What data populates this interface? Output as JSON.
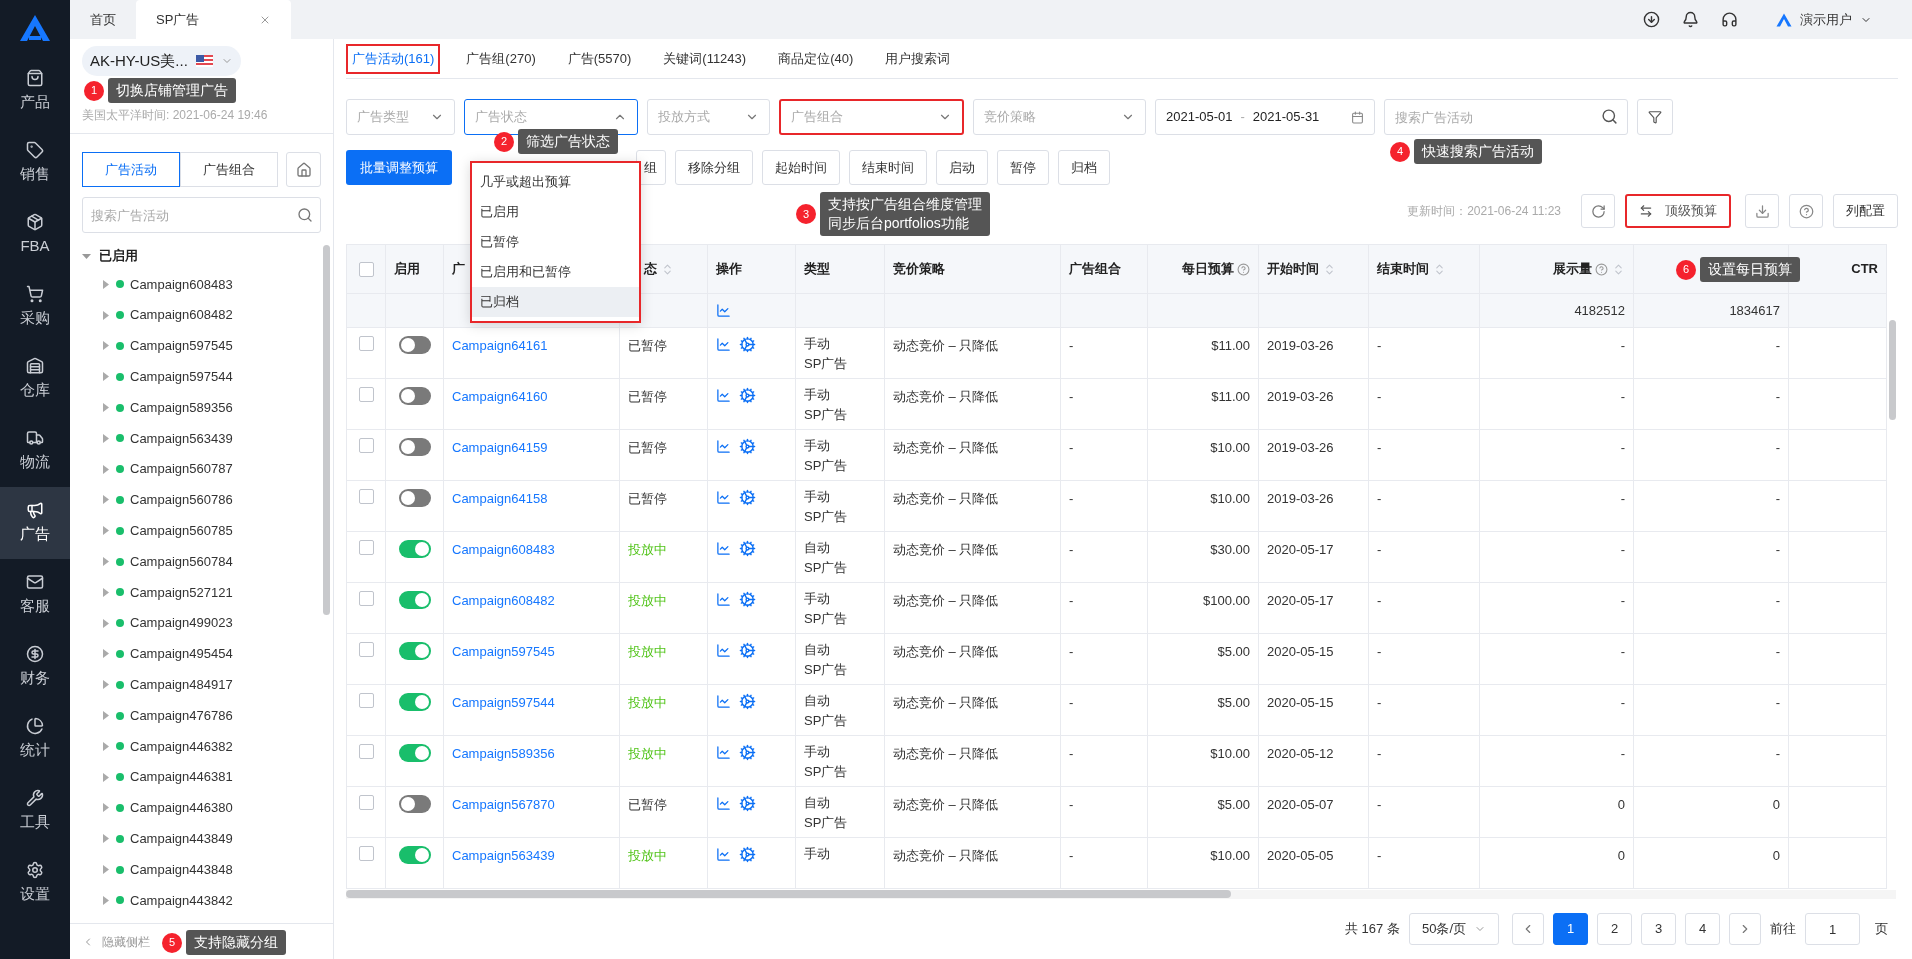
{
  "nav": {
    "items": [
      {
        "label": "产品",
        "selected": false
      },
      {
        "label": "销售",
        "selected": false
      },
      {
        "label": "FBA",
        "selected": false
      },
      {
        "label": "采购",
        "selected": false
      },
      {
        "label": "仓库",
        "selected": false
      },
      {
        "label": "物流",
        "selected": false
      },
      {
        "label": "广告",
        "selected": true
      },
      {
        "label": "客服",
        "selected": false
      },
      {
        "label": "财务",
        "selected": false
      },
      {
        "label": "统计",
        "selected": false
      },
      {
        "label": "工具",
        "selected": false
      },
      {
        "label": "设置",
        "selected": false
      }
    ]
  },
  "tabs": [
    {
      "label": "首页",
      "selected": false,
      "closable": false
    },
    {
      "label": "SP广告",
      "selected": true,
      "closable": true
    }
  ],
  "user": {
    "name": "演示用户"
  },
  "sidebar": {
    "store": "AK-HY-US美...",
    "time": "美国太平洋时间: 2021-06-24 19:46",
    "segments": [
      {
        "label": "广告活动",
        "selected": true
      },
      {
        "label": "广告组合",
        "selected": false
      }
    ],
    "search_placeholder": "搜索广告活动",
    "tree": {
      "label": "已启用",
      "expanded": true,
      "children": [
        {
          "label": "Campaign608483",
          "color": "#19be6b",
          "expanded": false
        },
        {
          "label": "Campaign608482",
          "color": "#19be6b",
          "expanded": false
        },
        {
          "label": "Campaign597545",
          "color": "#19be6b",
          "expanded": false
        },
        {
          "label": "Campaign597544",
          "color": "#19be6b",
          "expanded": false
        },
        {
          "label": "Campaign589356",
          "color": "#19be6b",
          "expanded": false
        },
        {
          "label": "Campaign563439",
          "color": "#19be6b",
          "expanded": false
        },
        {
          "label": "Campaign560787",
          "color": "#19be6b",
          "expanded": false
        },
        {
          "label": "Campaign560786",
          "color": "#19be6b",
          "expanded": false
        },
        {
          "label": "Campaign560785",
          "color": "#19be6b",
          "expanded": false
        },
        {
          "label": "Campaign560784",
          "color": "#19be6b",
          "expanded": false
        },
        {
          "label": "Campaign527121",
          "color": "#19be6b",
          "expanded": false
        },
        {
          "label": "Campaign499023",
          "color": "#19be6b",
          "expanded": false
        },
        {
          "label": "Campaign495454",
          "color": "#19be6b",
          "expanded": false
        },
        {
          "label": "Campaign484917",
          "color": "#19be6b",
          "expanded": false
        },
        {
          "label": "Campaign476786",
          "color": "#19be6b",
          "expanded": false
        },
        {
          "label": "Campaign446382",
          "color": "#19be6b",
          "expanded": false
        },
        {
          "label": "Campaign446381",
          "color": "#19be6b",
          "expanded": false
        },
        {
          "label": "Campaign446380",
          "color": "#19be6b",
          "expanded": false
        },
        {
          "label": "Campaign443849",
          "color": "#19be6b",
          "expanded": false
        },
        {
          "label": "Campaign443848",
          "color": "#19be6b",
          "expanded": false
        },
        {
          "label": "Campaign443842",
          "color": "#19be6b",
          "expanded": false
        }
      ]
    },
    "footer": "隐藏侧栏"
  },
  "page_tabs": [
    {
      "label": "广告活动(161)",
      "selected": true,
      "highlighted": true
    },
    {
      "label": "广告组(270)",
      "selected": false,
      "highlighted": false
    },
    {
      "label": "广告(5570)",
      "selected": false,
      "highlighted": false
    },
    {
      "label": "关键词(11243)",
      "selected": false,
      "highlighted": false
    },
    {
      "label": "商品定位(40)",
      "selected": false,
      "highlighted": false
    },
    {
      "label": "用户搜索词",
      "selected": false,
      "highlighted": false
    }
  ],
  "filters": [
    {
      "placeholder": "广告类型",
      "open": false,
      "highlighted": false
    },
    {
      "placeholder": "广告状态",
      "open": true,
      "highlighted": false
    },
    {
      "placeholder": "投放方式",
      "open": false,
      "highlighted": false
    },
    {
      "placeholder": "广告组合",
      "open": false,
      "highlighted": true
    },
    {
      "placeholder": "竞价策略",
      "open": false,
      "highlighted": false
    }
  ],
  "date_range": {
    "start": "2021-05-01",
    "separator": "-",
    "end": "2021-05-31"
  },
  "search": {
    "placeholder": "搜索广告活动"
  },
  "dropdown": {
    "highlighted": true,
    "items": [
      {
        "label": "几乎或超出预算",
        "hovered": false
      },
      {
        "label": "已启用",
        "hovered": false
      },
      {
        "label": "已暂停",
        "hovered": false
      },
      {
        "label": "已启用和已暂停",
        "hovered": false
      },
      {
        "label": "已归档",
        "hovered": true
      }
    ]
  },
  "actions": [
    {
      "label": "批量调整预算",
      "kind": "primary"
    },
    {
      "label": "组",
      "kind": "covered"
    },
    {
      "label": "移除分组",
      "kind": "default"
    },
    {
      "label": "起始时间",
      "kind": "default"
    },
    {
      "label": "结束时间",
      "kind": "default"
    },
    {
      "label": "启动",
      "kind": "default"
    },
    {
      "label": "暂停",
      "kind": "default"
    },
    {
      "label": "归档",
      "kind": "default"
    }
  ],
  "update_time": "更新时间：2021-06-24 11:23",
  "top_budget": {
    "label": "顶级预算",
    "highlighted": true
  },
  "column_config": "列配置",
  "table": {
    "all_checked": false,
    "columns": [
      {
        "kind": "checkbox"
      },
      {
        "label": "启用",
        "kind": "text",
        "sortable": false,
        "help": false
      },
      {
        "label": "广",
        "kind": "text"
      },
      {
        "label": "态",
        "kind": "text",
        "sortable": true,
        "help": false
      },
      {
        "label": "操作",
        "kind": "text",
        "sortable": false,
        "help": false
      },
      {
        "label": "类型",
        "kind": "text",
        "sortable": false,
        "help": false
      },
      {
        "label": "竞价策略",
        "kind": "text",
        "sortable": false,
        "help": false
      },
      {
        "label": "广告组合",
        "kind": "text",
        "sortable": false,
        "help": false
      },
      {
        "label": "每日预算",
        "kind": "right",
        "sortable": false,
        "help": true
      },
      {
        "label": "开始时间",
        "kind": "text",
        "sortable": true,
        "help": false
      },
      {
        "label": "结束时间",
        "kind": "text",
        "sortable": true,
        "help": false
      },
      {
        "label": "展示量",
        "kind": "right",
        "sortable": true,
        "help": true
      },
      {
        "kind": "right"
      },
      {
        "label": "CTR",
        "kind": "right",
        "sortable": false,
        "help": false
      }
    ],
    "summary": {
      "impressions": "4182512",
      "column_13": "1834617"
    },
    "rows": [
      {
        "checked": false,
        "on": false,
        "name": "Campaign64161",
        "status": "已暂停",
        "delivering": false,
        "type": [
          "手动",
          "SP广告"
        ],
        "bidding": "动态竞价 – 只降低",
        "portfolio": "-",
        "budget": "$11.00",
        "start": "2019-03-26",
        "end": "-",
        "impressions": "-",
        "column_13": "-"
      },
      {
        "checked": false,
        "on": false,
        "name": "Campaign64160",
        "status": "已暂停",
        "delivering": false,
        "type": [
          "手动",
          "SP广告"
        ],
        "bidding": "动态竞价 – 只降低",
        "portfolio": "-",
        "budget": "$11.00",
        "start": "2019-03-26",
        "end": "-",
        "impressions": "-",
        "column_13": "-"
      },
      {
        "checked": false,
        "on": false,
        "name": "Campaign64159",
        "status": "已暂停",
        "delivering": false,
        "type": [
          "手动",
          "SP广告"
        ],
        "bidding": "动态竞价 – 只降低",
        "portfolio": "-",
        "budget": "$10.00",
        "start": "2019-03-26",
        "end": "-",
        "impressions": "-",
        "column_13": "-"
      },
      {
        "checked": false,
        "on": false,
        "name": "Campaign64158",
        "status": "已暂停",
        "delivering": false,
        "type": [
          "手动",
          "SP广告"
        ],
        "bidding": "动态竞价 – 只降低",
        "portfolio": "-",
        "budget": "$10.00",
        "start": "2019-03-26",
        "end": "-",
        "impressions": "-",
        "column_13": "-"
      },
      {
        "checked": false,
        "on": true,
        "name": "Campaign608483",
        "status": "投放中",
        "delivering": true,
        "type": [
          "自动",
          "SP广告"
        ],
        "bidding": "动态竞价 – 只降低",
        "portfolio": "-",
        "budget": "$30.00",
        "start": "2020-05-17",
        "end": "-",
        "impressions": "-",
        "column_13": "-"
      },
      {
        "checked": false,
        "on": true,
        "name": "Campaign608482",
        "status": "投放中",
        "delivering": true,
        "type": [
          "手动",
          "SP广告"
        ],
        "bidding": "动态竞价 – 只降低",
        "portfolio": "-",
        "budget": "$100.00",
        "start": "2020-05-17",
        "end": "-",
        "impressions": "-",
        "column_13": "-"
      },
      {
        "checked": false,
        "on": true,
        "name": "Campaign597545",
        "status": "投放中",
        "delivering": true,
        "type": [
          "自动",
          "SP广告"
        ],
        "bidding": "动态竞价 – 只降低",
        "portfolio": "-",
        "budget": "$5.00",
        "start": "2020-05-15",
        "end": "-",
        "impressions": "-",
        "column_13": "-"
      },
      {
        "checked": false,
        "on": true,
        "name": "Campaign597544",
        "status": "投放中",
        "delivering": true,
        "type": [
          "自动",
          "SP广告"
        ],
        "bidding": "动态竞价 – 只降低",
        "portfolio": "-",
        "budget": "$5.00",
        "start": "2020-05-15",
        "end": "-",
        "impressions": "-",
        "column_13": "-"
      },
      {
        "checked": false,
        "on": true,
        "name": "Campaign589356",
        "status": "投放中",
        "delivering": true,
        "type": [
          "手动",
          "SP广告"
        ],
        "bidding": "动态竞价 – 只降低",
        "portfolio": "-",
        "budget": "$10.00",
        "start": "2020-05-12",
        "end": "-",
        "impressions": "-",
        "column_13": "-"
      },
      {
        "checked": false,
        "on": false,
        "name": "Campaign567870",
        "status": "已暂停",
        "delivering": false,
        "type": [
          "自动",
          "SP广告"
        ],
        "bidding": "动态竞价 – 只降低",
        "portfolio": "-",
        "budget": "$5.00",
        "start": "2020-05-07",
        "end": "-",
        "impressions": "0",
        "column_13": "0"
      },
      {
        "checked": false,
        "on": true,
        "name": "Campaign563439",
        "status": "投放中",
        "delivering": true,
        "type": [
          "手动"
        ],
        "bidding": "动态竞价 – 只降低",
        "portfolio": "-",
        "budget": "$10.00",
        "start": "2020-05-05",
        "end": "-",
        "impressions": "0",
        "column_13": "0"
      }
    ]
  },
  "pagination": {
    "total": "共 167 条",
    "page_size": "50条/页",
    "pages": [
      {
        "label": "1",
        "selected": true
      },
      {
        "label": "2",
        "selected": false
      },
      {
        "label": "3",
        "selected": false
      },
      {
        "label": "4",
        "selected": false
      }
    ],
    "goto_label": "前往",
    "goto_value": "1",
    "suffix": "页"
  },
  "annotations": [
    {
      "number": "1",
      "text": "切换店铺管理广告"
    },
    {
      "number": "2",
      "text": "筛选广告状态"
    },
    {
      "number": "3",
      "lines": [
        "支持按广告组合维度管理",
        "同步后台portfolios功能"
      ]
    },
    {
      "number": "4",
      "text": "快速搜索广告活动"
    },
    {
      "number": "5",
      "text": "支持隐藏分组"
    },
    {
      "number": "6",
      "text": "设置每日预算"
    }
  ]
}
